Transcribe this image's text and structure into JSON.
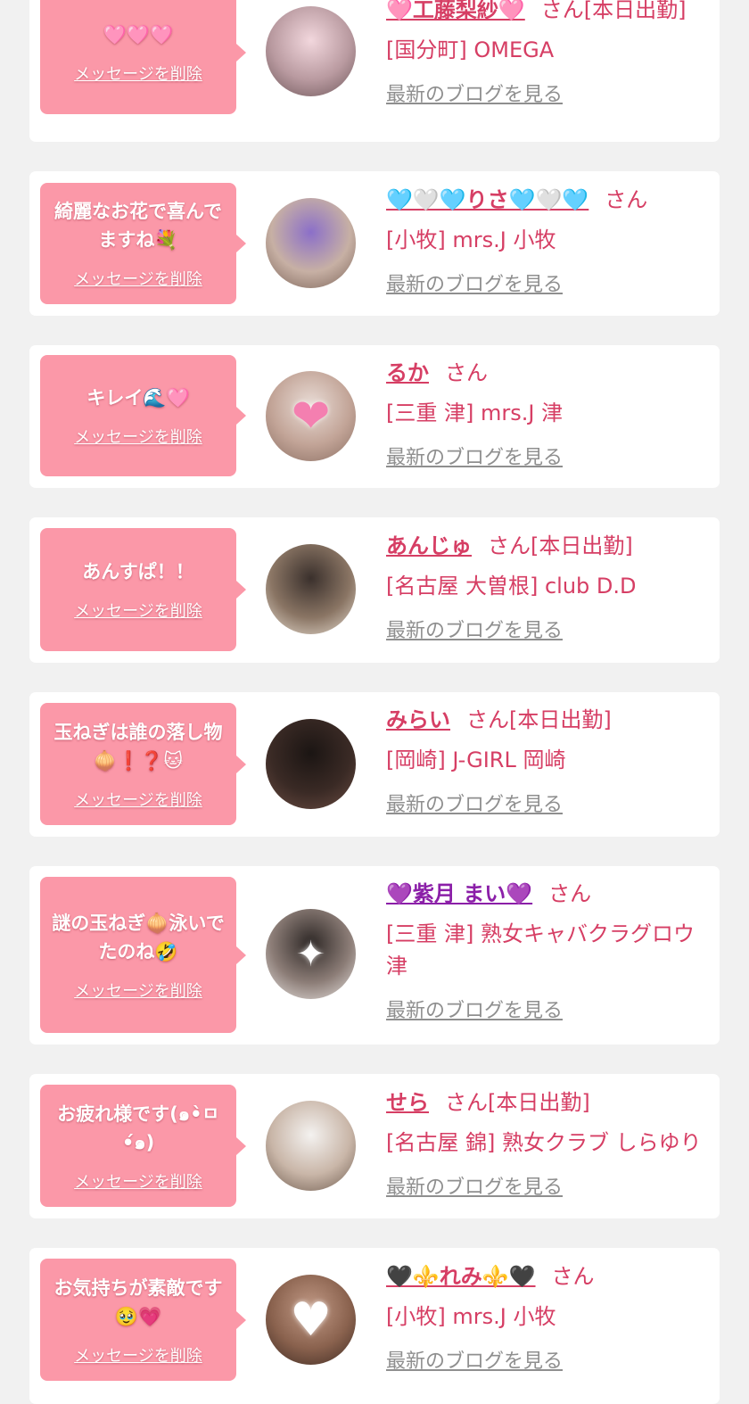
{
  "cards": [
    {
      "message": "🩷🩷🩷",
      "delete_label": "メッセージを削除",
      "name": "🩷工藤梨紗🩷",
      "name_color": "#d63e64",
      "san_label": "さん[本日出勤]",
      "shop": "[国分町] OMEGA",
      "blog_label": "最新のブログを見る",
      "avatar_icon": "bunny-hat-photo",
      "avatar_colors": [
        "#f2d7dd",
        "#b99aa0",
        "#6c5558"
      ],
      "avatar_glyph": ""
    },
    {
      "message": "綺麗なお花で喜んでますね💐",
      "delete_label": "メッセージを削除",
      "name": "🩵🤍🩵りさ🩵🤍🩵",
      "name_color": "#d63e64",
      "san_label": "さん",
      "shop": "[小牧] mrs.J 小牧",
      "blog_label": "最新のブログを見る",
      "avatar_icon": "purple-hair-photo",
      "avatar_colors": [
        "#8b6fc9",
        "#c7b0a4",
        "#7a6257"
      ],
      "avatar_glyph": ""
    },
    {
      "message": "キレイ🌊🩷",
      "delete_label": "メッセージを削除",
      "name": "るか",
      "name_color": "#d63e64",
      "san_label": "さん",
      "shop": "[三重 津] mrs.J 津",
      "blog_label": "最新のブログを見る",
      "avatar_icon": "heart-face-photo",
      "avatar_colors": [
        "#e9dcd6",
        "#c2a497",
        "#8a6e62"
      ],
      "avatar_glyph": "❤"
    },
    {
      "message": "あんすぱ！！",
      "delete_label": "メッセージを削除",
      "name": "あんじゅ",
      "name_color": "#d63e64",
      "san_label": "さん[本日出勤]",
      "shop": "[名古屋 大曽根] club D.D",
      "blog_label": "最新のブログを見る",
      "avatar_icon": "business-card-photo",
      "avatar_colors": [
        "#3a302c",
        "#8a7564",
        "#e7ddd1"
      ],
      "avatar_glyph": ""
    },
    {
      "message": "玉ねぎは誰の落し物🧅❗❓🐱",
      "delete_label": "メッセージを削除",
      "name": "みらい",
      "name_color": "#d63e64",
      "san_label": "さん[本日出勤]",
      "shop": "[岡崎] J-GIRL 岡崎",
      "blog_label": "最新のブログを見る",
      "avatar_icon": "dark-portrait-photo",
      "avatar_colors": [
        "#1b1513",
        "#3a2a25",
        "#6b4c42"
      ],
      "avatar_glyph": ""
    },
    {
      "message": "謎の玉ねぎ🧅泳いでたのね🤣",
      "delete_label": "メッセージを削除",
      "name": "💜紫月 まい💜",
      "name_color": "#8b1fa8",
      "san_label": "さん",
      "shop": "[三重 津] 熟女キャバクラグロウ津",
      "blog_label": "最新のブログを見る",
      "avatar_icon": "sparkle-portrait-photo",
      "avatar_colors": [
        "#2e2826",
        "#8c7d77",
        "#e9e4e1"
      ],
      "avatar_glyph": "✦"
    },
    {
      "message": "お疲れ様です(๑•̀ㅁ•́๑)",
      "delete_label": "メッセージを削除",
      "name": "せら",
      "name_color": "#d63e64",
      "san_label": "さん[本日出勤]",
      "shop": "[名古屋 錦] 熟女クラブ しらゆり",
      "blog_label": "最新のブログを見る",
      "avatar_icon": "light-portrait-photo",
      "avatar_colors": [
        "#f4f2f0",
        "#c9b6a8",
        "#6d5a4d"
      ],
      "avatar_glyph": ""
    },
    {
      "message": "お気持ちが素敵です🥹💗",
      "delete_label": "メッセージを削除",
      "name": "🖤⚜️れみ⚜️🖤",
      "name_color": "#d63e64",
      "san_label": "さん",
      "shop": "[小牧] mrs.J 小牧",
      "blog_label": "最新のブログを見る",
      "avatar_icon": "heart-face-photo",
      "avatar_colors": [
        "#c29a86",
        "#8a624e",
        "#3e2a22"
      ],
      "avatar_glyph": "♥"
    }
  ]
}
